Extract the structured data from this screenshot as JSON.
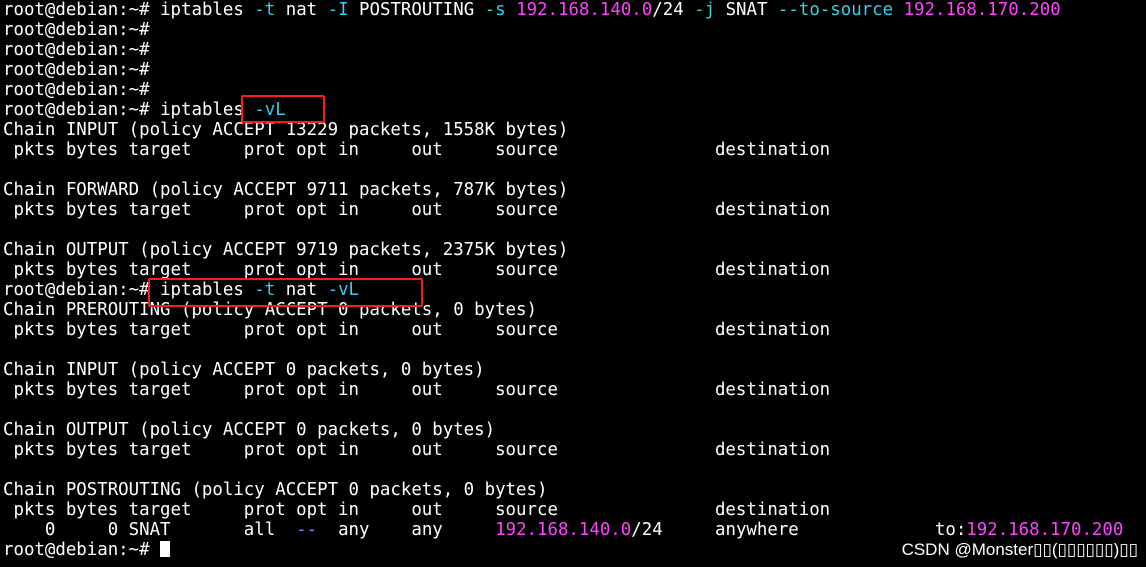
{
  "terminal": {
    "prompt": "root@debian:~# ",
    "lines": [
      {
        "cmd": "iptables -t nat -I POSTROUTING -s 192.168.140.0/24 -j SNAT --to-source 192.168.170.200"
      },
      {
        "cmd": ""
      },
      {
        "cmd": ""
      },
      {
        "cmd": ""
      },
      {
        "cmd": ""
      },
      {
        "cmd": "iptables -vL"
      },
      {
        "out": "Chain INPUT (policy ACCEPT 13229 packets, 1558K bytes)"
      },
      {
        "out": " pkts bytes target     prot opt in     out     source               destination"
      },
      {
        "out": ""
      },
      {
        "out": "Chain FORWARD (policy ACCEPT 9711 packets, 787K bytes)"
      },
      {
        "out": " pkts bytes target     prot opt in     out     source               destination"
      },
      {
        "out": ""
      },
      {
        "out": "Chain OUTPUT (policy ACCEPT 9719 packets, 2375K bytes)"
      },
      {
        "out": " pkts bytes target     prot opt in     out     source               destination"
      },
      {
        "cmd": "iptables -t nat -vL"
      },
      {
        "out": "Chain PREROUTING (policy ACCEPT 0 packets, 0 bytes)"
      },
      {
        "out": " pkts bytes target     prot opt in     out     source               destination"
      },
      {
        "out": ""
      },
      {
        "out": "Chain INPUT (policy ACCEPT 0 packets, 0 bytes)"
      },
      {
        "out": " pkts bytes target     prot opt in     out     source               destination"
      },
      {
        "out": ""
      },
      {
        "out": "Chain OUTPUT (policy ACCEPT 0 packets, 0 bytes)"
      },
      {
        "out": " pkts bytes target     prot opt in     out     source               destination"
      },
      {
        "out": ""
      },
      {
        "out": "Chain POSTROUTING (policy ACCEPT 0 packets, 0 bytes)"
      },
      {
        "out": " pkts bytes target     prot opt in     out     source               destination"
      },
      {
        "out": "    0     0 SNAT       all  --  any    any     192.168.140.0/24     anywhere             to:192.168.170.200"
      },
      {
        "cmd": "",
        "cursor": true
      }
    ]
  },
  "colors": {
    "background": "#000000",
    "text": "#ffffff",
    "ip": "#ff40ff",
    "flag": "#34d0e6",
    "highlight_box": "#ff1a1a"
  },
  "watermark": "CSDN @Monster▯▯(▯▯▯▯▯▯)▯▯"
}
